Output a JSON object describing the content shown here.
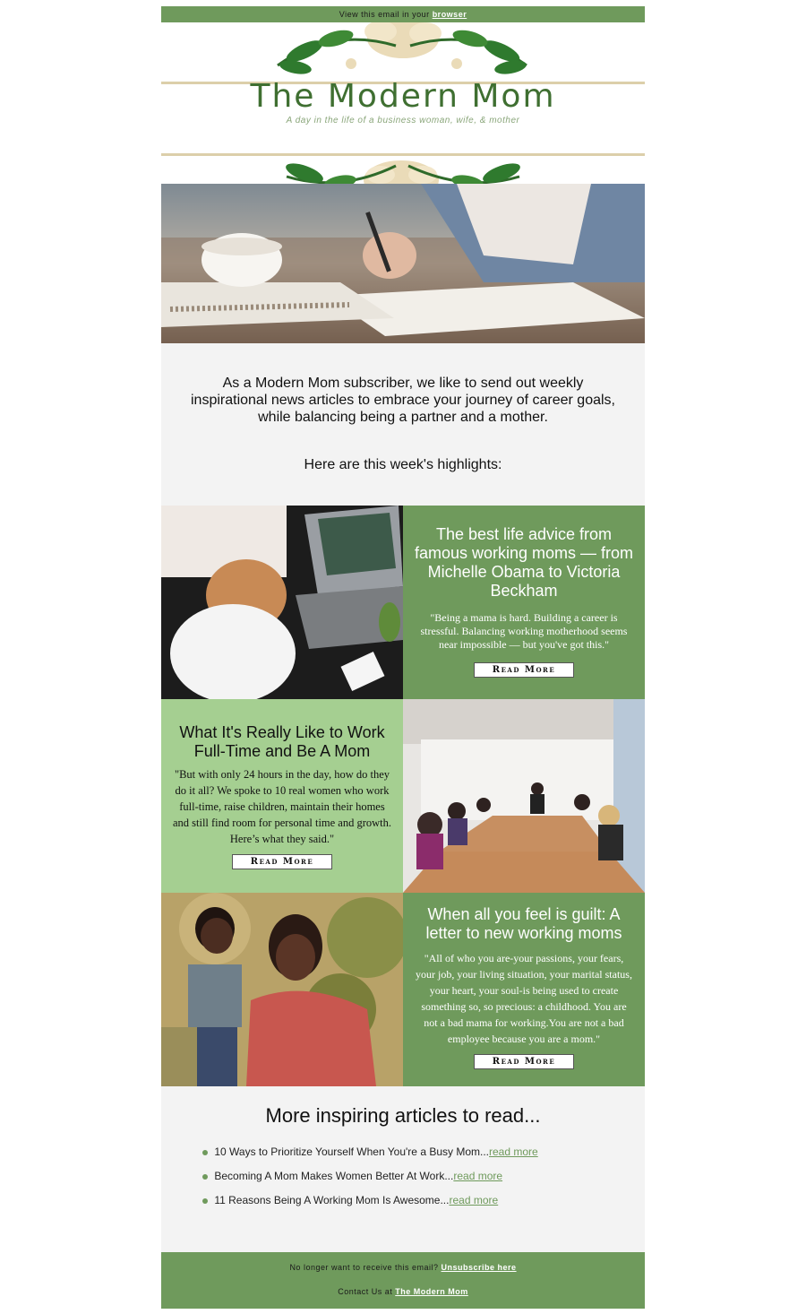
{
  "topbar": {
    "prefix": "View this email in your",
    "link": "browser"
  },
  "header": {
    "title": "The Modern Mom",
    "tagline": "A day in the life of a business woman, wife, & mother"
  },
  "intro": {
    "text": "As a Modern Mom subscriber, we like to send out weekly inspirational news articles to embrace your journey of career goals, while balancing being a partner and a mother.",
    "highlights": "Here are this week's highlights:"
  },
  "articles": [
    {
      "title": "The best life advice from famous working moms — from Michelle Obama to Victoria Beckham",
      "quote": "\"Being a mama is hard. Building a career is stressful. Balancing working motherhood seems near impossible — but you've got this.\"",
      "button": "Read More"
    },
    {
      "title": "What It's Really Like to Work Full-Time and Be A Mom",
      "quote": "\"But with only 24 hours in the day, how do they do it all? We spoke to 10 real women who work full-time, raise children, maintain their homes and still find room for personal time and growth. Here’s what they said.\"",
      "button": "Read More"
    },
    {
      "title": "When all you feel is guilt: A letter to new working moms",
      "quote": "\"All of who you are-your passions, your fears, your job, your living situation, your marital status, your heart, your soul-is being used to create something so, so precious: a childhood. You are not a bad mama for working.You are not a bad employee because you are a mom.\"",
      "button": "Read More"
    }
  ],
  "more": {
    "heading": "More inspiring articles to read...",
    "items": [
      {
        "text": "10 Ways to Prioritize Yourself When You're a Busy Mom...",
        "link": "read more"
      },
      {
        "text": "Becoming A Mom Makes Women Better At Work...",
        "link": "read more"
      },
      {
        "text": "11 Reasons Being A Working Mom Is Awesome...",
        "link": "read more"
      }
    ]
  },
  "footer": {
    "unsubscribe_prefix": "No longer want to receive this email?",
    "unsubscribe_link": "Unsubscribe here",
    "contact_prefix": "Contact Us at",
    "contact_link": "The Modern Mom"
  },
  "colors": {
    "brand_green": "#6f9a5c",
    "light_green": "#a5cf91",
    "beige": "#dccfaa",
    "bg_gray": "#f3f3f3"
  }
}
